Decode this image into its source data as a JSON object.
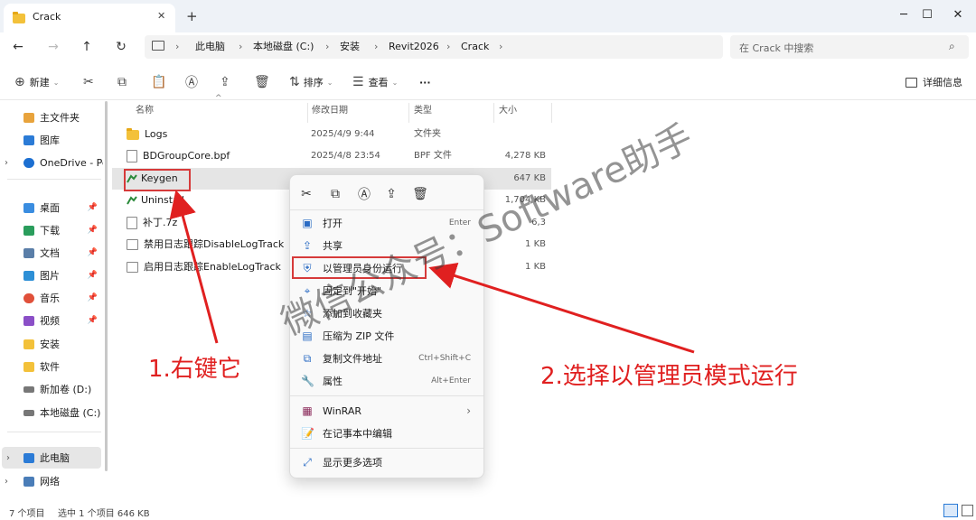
{
  "window": {
    "tab_title": "Crack",
    "new_tab": "+",
    "close_tab": "✕",
    "minimize": "─",
    "maximize": "☐",
    "close": "✕"
  },
  "address": {
    "crumbs": [
      "此电脑",
      "本地磁盘 (C:)",
      "安装",
      "Revit2026",
      "Crack"
    ],
    "search_placeholder": "在 Crack 中搜索"
  },
  "toolbar": {
    "new_label": "新建",
    "sort_label": "排序",
    "view_label": "查看",
    "more_label": "···",
    "details_label": "详细信息"
  },
  "sidebar": {
    "items": [
      {
        "label": "主文件夹",
        "color": "#e8a33c"
      },
      {
        "label": "图库",
        "color": "#2b7bd6"
      },
      {
        "label": "OneDrive - Per",
        "color": "#1c6fd1"
      },
      {
        "label": "桌面",
        "color": "#3a8de0"
      },
      {
        "label": "下载",
        "color": "#2a9d5c"
      },
      {
        "label": "文档",
        "color": "#5a7ea8"
      },
      {
        "label": "图片",
        "color": "#2d8fd6"
      },
      {
        "label": "音乐",
        "color": "#e0503a"
      },
      {
        "label": "视频",
        "color": "#8b4fc7"
      },
      {
        "label": "安装",
        "color": "#f3c13a"
      },
      {
        "label": "软件",
        "color": "#f3c13a"
      },
      {
        "label": "新加卷 (D:)",
        "color": "#777777"
      },
      {
        "label": "本地磁盘 (C:)",
        "color": "#777777"
      },
      {
        "label": "此电脑",
        "color": "#2b7bd6"
      },
      {
        "label": "网络",
        "color": "#4a7db8"
      }
    ]
  },
  "columns": {
    "name": "名称",
    "date": "修改日期",
    "type": "类型",
    "size": "大小"
  },
  "files": [
    {
      "name": "Logs",
      "date": "2025/4/9 9:44",
      "type": "文件夹",
      "size": ""
    },
    {
      "name": "BDGroupCore.bpf",
      "date": "2025/4/8 23:54",
      "type": "BPF 文件",
      "size": "4,278 KB"
    },
    {
      "name": "Keygen",
      "date": "",
      "type": "",
      "size": "647 KB"
    },
    {
      "name": "Uninstall",
      "date": "",
      "type": "",
      "size": "1,704 KB"
    },
    {
      "name": "补丁.7z",
      "date": "",
      "type": "",
      "size": "6,3"
    },
    {
      "name": "禁用日志跟踪DisableLogTrack",
      "date": "",
      "type": "",
      "size": "1 KB"
    },
    {
      "name": "启用日志跟踪EnableLogTrack",
      "date": "",
      "type": "本",
      "size": "1 KB"
    }
  ],
  "context_menu": {
    "open": {
      "label": "打开",
      "shortcut": "Enter"
    },
    "share": "共享",
    "run_as_admin": "以管理员身份运行",
    "pin_start": "固定到\"开始\"",
    "add_favorites": "添加到收藏夹",
    "compress_zip": "压缩为 ZIP 文件",
    "copy_path": {
      "label": "复制文件地址",
      "shortcut": "Ctrl+Shift+C"
    },
    "properties": {
      "label": "属性",
      "shortcut": "Alt+Enter"
    },
    "winrar": "WinRAR",
    "notepad": "在记事本中编辑",
    "more_options": "显示更多选项"
  },
  "annotations": {
    "step1": "1.右键它",
    "step2": "2.选择以管理员模式运行",
    "watermark": "微信公众号：Software助手",
    "color": "#e02020"
  },
  "status": {
    "item_count": "7 个项目",
    "selected": "选中 1 个项目  646 KB"
  }
}
